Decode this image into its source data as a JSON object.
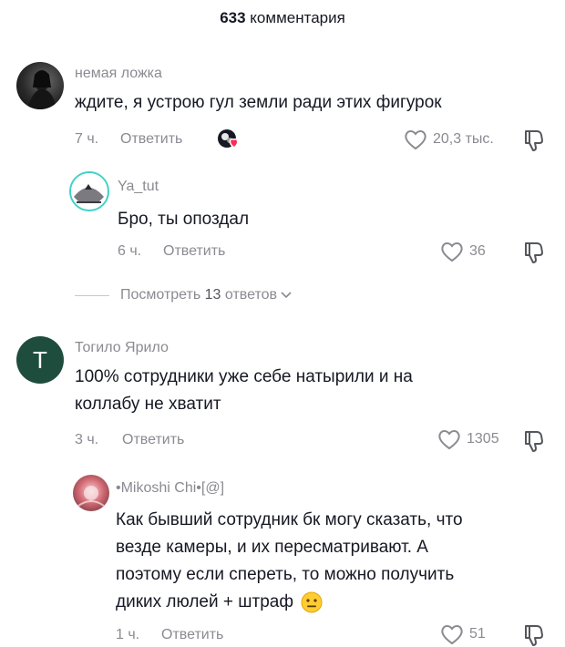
{
  "header": {
    "count": "633",
    "label": "комментария"
  },
  "comments": [
    {
      "username": "немая ложка",
      "text": "ждите, я устрою гул земли ради этих фигурок",
      "time": "7 ч.",
      "reply_label": "Ответить",
      "likes": "20,3 тыс.",
      "avatar_icon": "profile-photo-icon"
    },
    {
      "username": "Ya_tut",
      "text": "Бро, ты опоздал",
      "time": "6 ч.",
      "reply_label": "Ответить",
      "likes": "36",
      "avatar_icon": "profile-photo-icon"
    },
    {
      "username": "Тогило Ярило",
      "text_line1": "100% сотрудники уже себе натырили и на",
      "text_line2": "коллабу не хватит",
      "time": "3 ч.",
      "reply_label": "Ответить",
      "likes": "1305",
      "avatar_letter": "T",
      "avatar_color": "#1f4d3d"
    },
    {
      "username": "•Mikoshi Chi•[@]",
      "text_line1": "Как бывший сотрудник бк могу сказать, что",
      "text_line2": "везде камеры, и их пересматривают. А",
      "text_line3": "поэтому если спереть, то можно получить",
      "text_line4": "диких люлей + штраф",
      "time": "1 ч.",
      "reply_label": "Ответить",
      "likes": "51",
      "avatar_icon": "profile-photo-icon",
      "emoji_icon": "neutral-face-emoji-icon"
    }
  ],
  "view_replies": {
    "prefix": "Посмотреть",
    "count": "13",
    "suffix": "ответов"
  },
  "colors": {
    "text": "#161823",
    "secondary": "#8a8b91",
    "avatar_t": "#1f4d3d"
  }
}
